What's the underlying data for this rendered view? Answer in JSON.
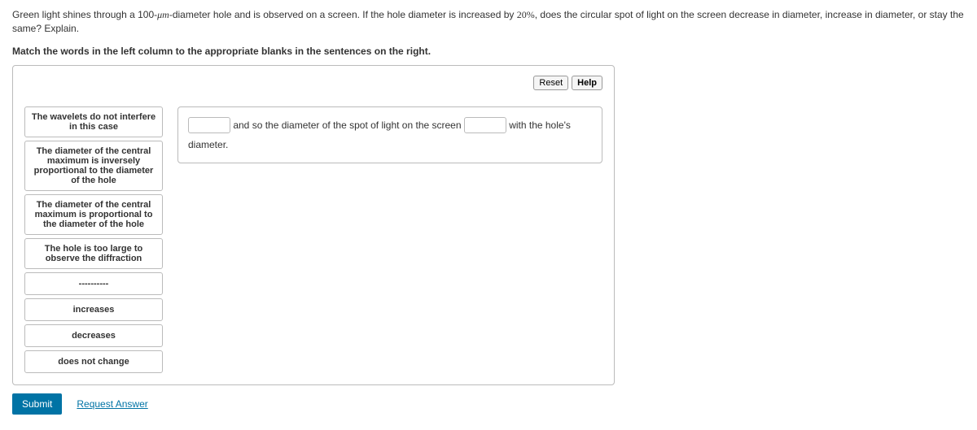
{
  "question": {
    "pre": "Green light shines through a 100-",
    "unit": "μm",
    "mid": "-diameter hole and is observed on a screen. If the hole diameter is increased by ",
    "pct": "20%",
    "post": ", does the circular spot of light on the screen decrease in diameter, increase in diameter, or stay the same? Explain."
  },
  "instruction": "Match the words in the left column to the appropriate blanks in the sentences on the right.",
  "buttons": {
    "reset": "Reset",
    "help": "Help",
    "submit": "Submit",
    "request": "Request Answer"
  },
  "options": [
    "The wavelets do not interfere in this case",
    "The diameter of the central maximum is inversely proportional to the diameter of the hole",
    "The diameter of the central maximum is proportional to the diameter of the hole",
    "The hole is too large to observe the diffraction",
    "----------",
    "increases",
    "decreases",
    "does not change"
  ],
  "sentence": {
    "part1": " and so the diameter of the spot of light on the screen ",
    "part2": " with the hole's diameter."
  }
}
